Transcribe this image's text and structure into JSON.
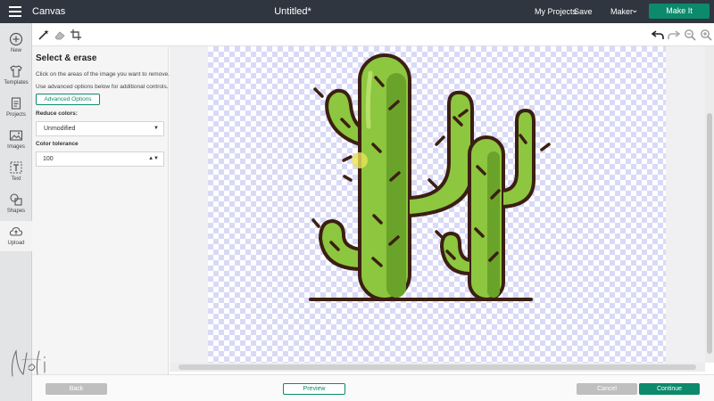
{
  "topbar": {
    "app_title": "Canvas",
    "document_title": "Untitled*",
    "my_projects": "My Projects",
    "save": "Save",
    "machine": "Maker",
    "make_it": "Make It",
    "accent_color": "#0c8a6b",
    "bg_color": "#2f3640"
  },
  "toolbar": {
    "left_tools": [
      "magic-wand-icon",
      "eraser-icon",
      "crop-icon"
    ],
    "right_tools": [
      "undo-icon",
      "redo-icon",
      "zoom-out-icon",
      "zoom-in-icon"
    ]
  },
  "leftnav": {
    "items": [
      {
        "label": "New",
        "icon": "plus-circle-icon"
      },
      {
        "label": "Templates",
        "icon": "shirt-icon"
      },
      {
        "label": "Projects",
        "icon": "document-icon"
      },
      {
        "label": "Images",
        "icon": "image-icon"
      },
      {
        "label": "Text",
        "icon": "text-icon"
      },
      {
        "label": "Shapes",
        "icon": "shapes-icon"
      },
      {
        "label": "Upload",
        "icon": "upload-cloud-icon"
      }
    ]
  },
  "panel": {
    "title": "Select & erase",
    "help_line_1": "Click on the areas of the image you want to remove.",
    "help_line_2": "Use advanced options below for additional controls.",
    "advanced_options": "Advanced Options",
    "reduce_colors_label": "Reduce colors:",
    "reduce_colors_value": "Unmodified",
    "color_tolerance_label": "Color tolerance",
    "color_tolerance_value": "100"
  },
  "canvas": {
    "image_subject": "cactus illustration on transparent background",
    "cactus_colors": {
      "body": "#8dc63f",
      "shade": "#6aa32a",
      "outline": "#3b1f12"
    },
    "checker_color": "#d9d9f7"
  },
  "bottombar": {
    "back": "Back",
    "preview": "Preview",
    "cancel": "Cancel",
    "continue": "Continue"
  },
  "watermark": {
    "signature": "Neli"
  }
}
